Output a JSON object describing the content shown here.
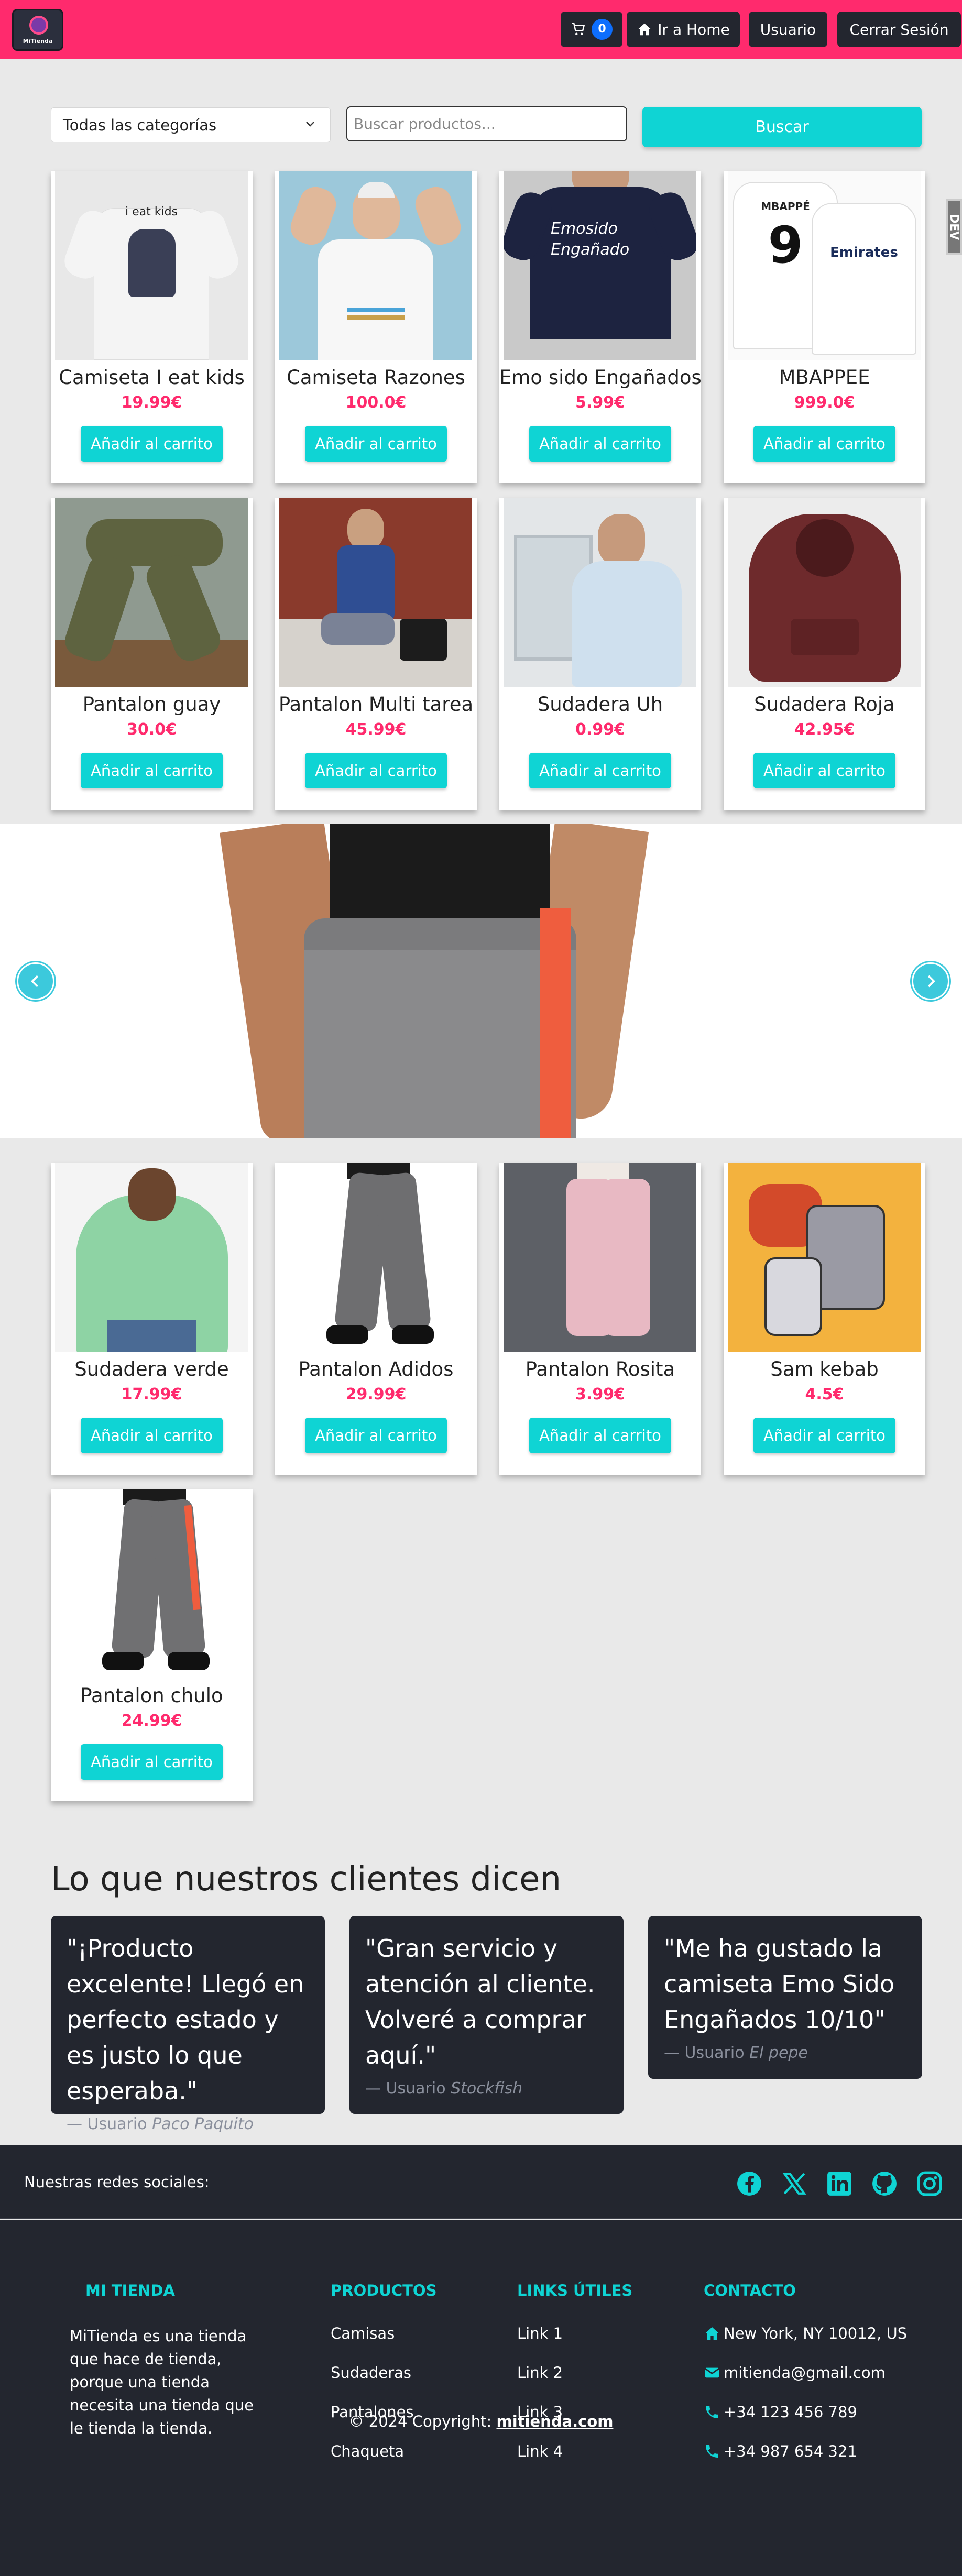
{
  "navbar": {
    "logo_text": "MiTienda",
    "cart_count": "0",
    "home_label": "Ir a Home",
    "user_label": "Usuario",
    "logout_label": "Cerrar Sesión"
  },
  "search": {
    "category_selected": "Todas las categorías",
    "placeholder": "Buscar productos...",
    "button_label": "Buscar"
  },
  "side_tab": "DEV",
  "products": [
    {
      "name": "Camiseta I eat kids",
      "price": "19.99€",
      "button": "Añadir al carrito",
      "print": "i eat kids"
    },
    {
      "name": "Camiseta Razones",
      "price": "100.0€",
      "button": "Añadir al carrito"
    },
    {
      "name": "Emo sido Engañados",
      "price": "5.99€",
      "button": "Añadir al carrito",
      "print": "Emosido Engañado"
    },
    {
      "name": "MBAPPEE",
      "price": "999.0€",
      "button": "Añadir al carrito",
      "print": "MBAPPÉ",
      "number": "9",
      "sponsor": "Emirates"
    },
    {
      "name": "Pantalon guay",
      "price": "30.0€",
      "button": "Añadir al carrito"
    },
    {
      "name": "Pantalon Multi tarea",
      "price": "45.99€",
      "button": "Añadir al carrito"
    },
    {
      "name": "Sudadera Uh",
      "price": "0.99€",
      "button": "Añadir al carrito"
    },
    {
      "name": "Sudadera Roja",
      "price": "42.95€",
      "button": "Añadir al carrito"
    },
    {
      "name": "Sudadera verde",
      "price": "17.99€",
      "button": "Añadir al carrito"
    },
    {
      "name": "Pantalon Adidos",
      "price": "29.99€",
      "button": "Añadir al carrito"
    },
    {
      "name": "Pantalon Rosita",
      "price": "3.99€",
      "button": "Añadir al carrito"
    },
    {
      "name": "Sam kebab",
      "price": "4.5€",
      "button": "Añadir al carrito"
    },
    {
      "name": "Pantalon chulo",
      "price": "24.99€",
      "button": "Añadir al carrito"
    }
  ],
  "testimonials": {
    "heading": "Lo que nuestros clientes dicen",
    "items": [
      {
        "quote": "\"¡Producto excelente! Llegó en perfecto estado y es justo lo que esperaba.\"",
        "prefix": "— Usuario",
        "name": "Paco Paquito"
      },
      {
        "quote": "\"Gran servicio y atención al cliente. Volveré a comprar aquí.\"",
        "prefix": "— Usuario",
        "name": "Stockfish"
      },
      {
        "quote": "\"Me ha gustado la camiseta Emo Sido Engañados 10/10\"",
        "prefix": "— Usuario",
        "name": "El pepe"
      }
    ]
  },
  "footer": {
    "social_label": "Nuestras redes sociales:",
    "social_icons": [
      "facebook-icon",
      "x-icon",
      "linkedin-icon",
      "github-icon",
      "instagram-icon"
    ],
    "about_title": "MI TIENDA",
    "about_text": "MiTienda es una tienda que hace de tienda, porque una tienda necesita una tienda que le tienda la tienda.",
    "products_title": "PRODUCTOS",
    "products_links": [
      "Camisas",
      "Sudaderas",
      "Pantalones",
      "Chaqueta"
    ],
    "useful_title": "LINKS ÚTILES",
    "useful_links": [
      "Link 1",
      "Link 2",
      "Link 3",
      "Link 4"
    ],
    "contact_title": "CONTACTO",
    "contact_address": "New York, NY 10012, US",
    "contact_email": "mitienda@gmail.com",
    "contact_phone1": "+34 123 456 789",
    "contact_phone2": "+34 987 654 321",
    "copyright_prefix": "© 2024 Copyright:",
    "copyright_link": "mitienda.com"
  },
  "colors": {
    "brand": "#ff2a6d",
    "accent": "#0fd4d4",
    "dark": "#23262f"
  }
}
